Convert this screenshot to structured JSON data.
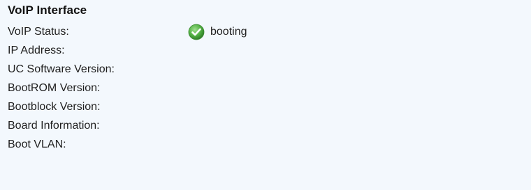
{
  "panel": {
    "title": "VoIP Interface",
    "rows": [
      {
        "label": "VoIP Status:",
        "value": "booting",
        "icon": "check-circle-icon",
        "icon_color": "#52b043"
      },
      {
        "label": "IP Address:",
        "value": ""
      },
      {
        "label": "UC Software Version:",
        "value": ""
      },
      {
        "label": "BootROM Version:",
        "value": ""
      },
      {
        "label": "Bootblock Version:",
        "value": ""
      },
      {
        "label": "Board Information:",
        "value": ""
      },
      {
        "label": "Boot VLAN:",
        "value": ""
      }
    ]
  },
  "colors": {
    "background": "#f3f8fd",
    "text": "#1f1f1f",
    "status_ok": "#52b043"
  }
}
